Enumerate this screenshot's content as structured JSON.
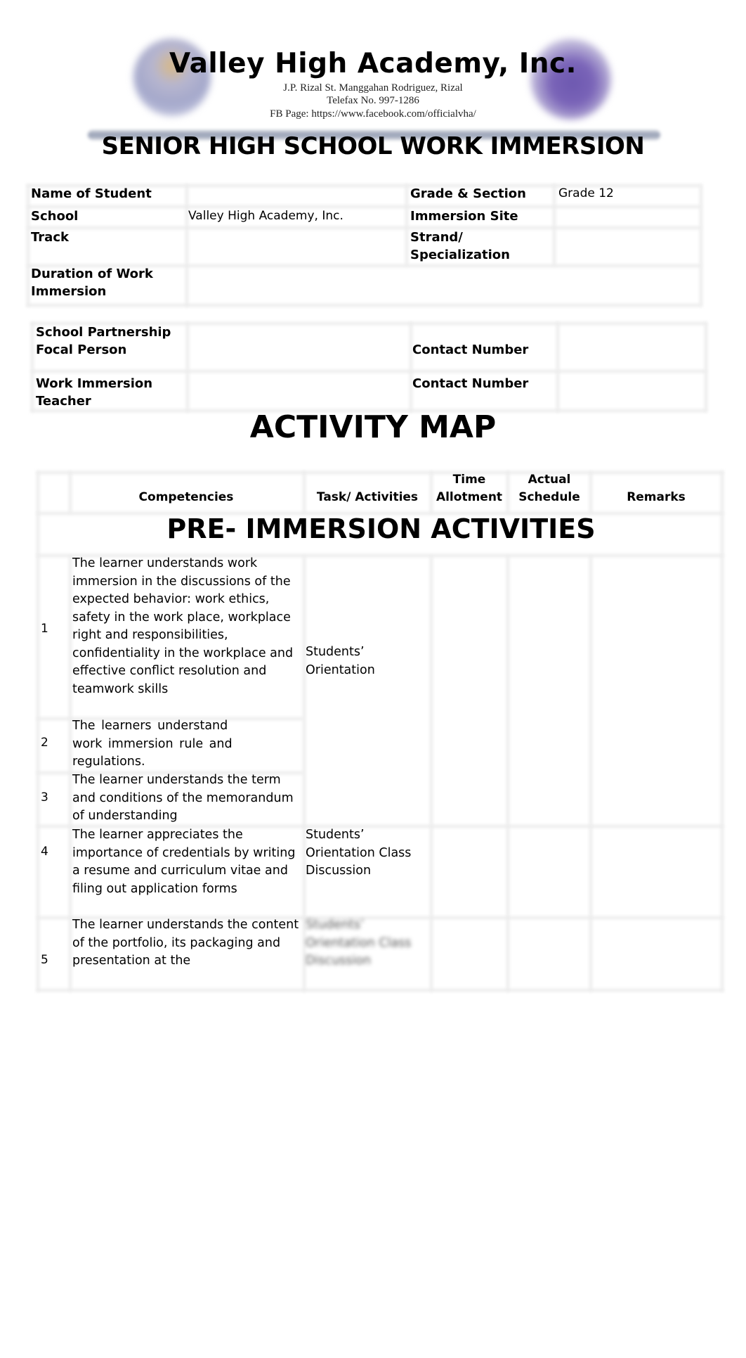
{
  "header": {
    "school_name": "Valley High Academy, Inc.",
    "address": "J.P. Rizal St. Manggahan Rodriguez, Rizal",
    "telefax": "Telefax No. 997-1286",
    "fb_page": "FB Page: https://www.facebook.com/officialvha/",
    "form_title": "SENIOR HIGH SCHOOL WORK IMMERSION",
    "logos": [
      "school-seal-logo",
      "deped-seal-logo"
    ],
    "bar_color": "#97a0b5"
  },
  "student_info": {
    "name_label": "Name of Student",
    "name_value": "",
    "grade_label": "Grade & Section",
    "grade_value": "Grade 12",
    "school_label": "School",
    "school_value": "Valley High Academy, Inc.",
    "site_label": "Immersion Site",
    "site_value": "",
    "track_label": "Track",
    "track_value": "",
    "strand_label_1": "Strand/",
    "strand_label_2": "Specialization",
    "strand_value": "",
    "duration_label_1": "Duration of Work",
    "duration_label_2": "Immersion",
    "duration_value": ""
  },
  "contacts": {
    "focal_label_1": "School Partnership",
    "focal_label_2": "Focal Person",
    "focal_value": "",
    "focal_contact_label": "Contact Number",
    "focal_contact_value": "",
    "teacher_label_1": "Work Immersion",
    "teacher_label_2": "Teacher",
    "teacher_value": "",
    "teacher_contact_label": "Contact Number",
    "teacher_contact_value": ""
  },
  "activity_map": {
    "title": "ACTIVITY MAP",
    "columns": {
      "competencies": "Competencies",
      "tasks": "Task/ Activities",
      "time_1": "Time",
      "time_2": "Allotment",
      "actual_1": "Actual",
      "actual_2": "Schedule",
      "remarks": "Remarks"
    },
    "section_title": "PRE- IMMERSION ACTIVITIES",
    "rows": [
      {
        "num": "1",
        "competency": "The learner understands work immersion in the discussions of the expected behavior: work ethics, safety in the work place, workplace right and responsibilities, confidentiality in the workplace and effective conflict resolution and teamwork skills",
        "task": "Students’ Orientation"
      },
      {
        "num": "2",
        "competency": "The learners understand work immersion rule and regulations.",
        "task": ""
      },
      {
        "num": "3",
        "competency": "The learner understands the term and conditions of the memorandum of understanding",
        "task": ""
      },
      {
        "num": "4",
        "competency": "The learner appreciates the importance of credentials by writing a resume and curriculum vitae and filing out application forms",
        "task": "Students’ Orientation Class Discussion"
      },
      {
        "num": "5",
        "competency": "The learner understands the content of the portfolio, its packaging and presentation at the",
        "task": "Students’ Orientation Class Discussion"
      }
    ]
  }
}
